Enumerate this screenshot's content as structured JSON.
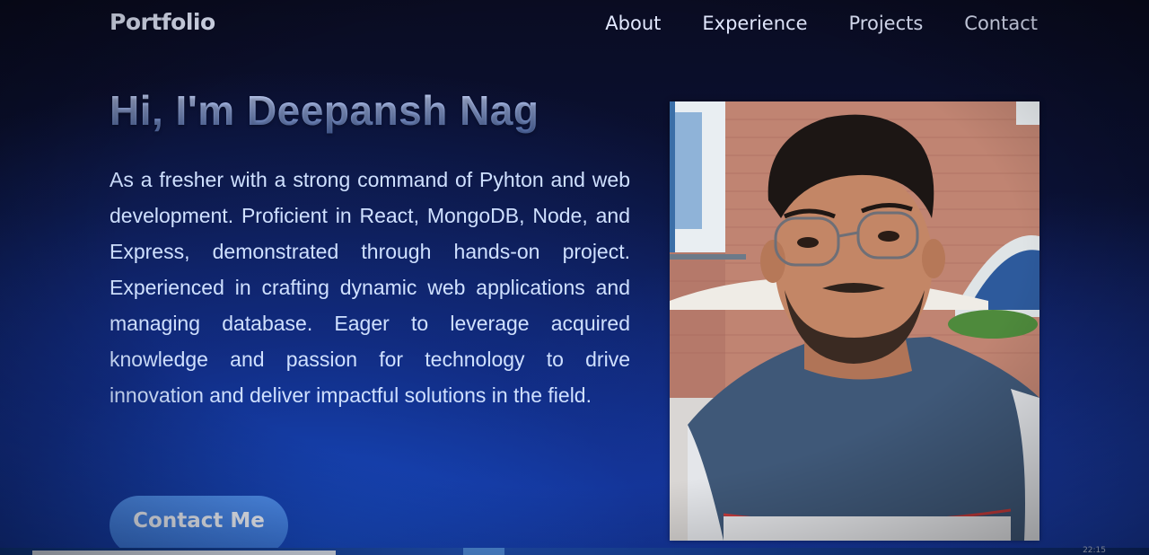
{
  "header": {
    "brand": "Portfolio",
    "nav": [
      "About",
      "Experience",
      "Projects",
      "Contact"
    ]
  },
  "hero": {
    "title": "Hi, I'm Deepansh Nag",
    "description": "As a fresher with a strong command of Pyhton and web development. Proficient in React, MongoDB, Node, and Express, demonstrated through hands-on project. Experienced in crafting dynamic web applications and managing database. Eager to leverage acquired knowledge and passion for technology to drive innovation and deliver impactful solutions in the field.",
    "cta_label": "Contact Me"
  },
  "taskbar": {
    "clock": "22:15"
  },
  "colors": {
    "accent": "#3a78e0",
    "background_top": "#0a0c22",
    "background_bottom": "#1536a0",
    "text": "#cfe0ff"
  }
}
